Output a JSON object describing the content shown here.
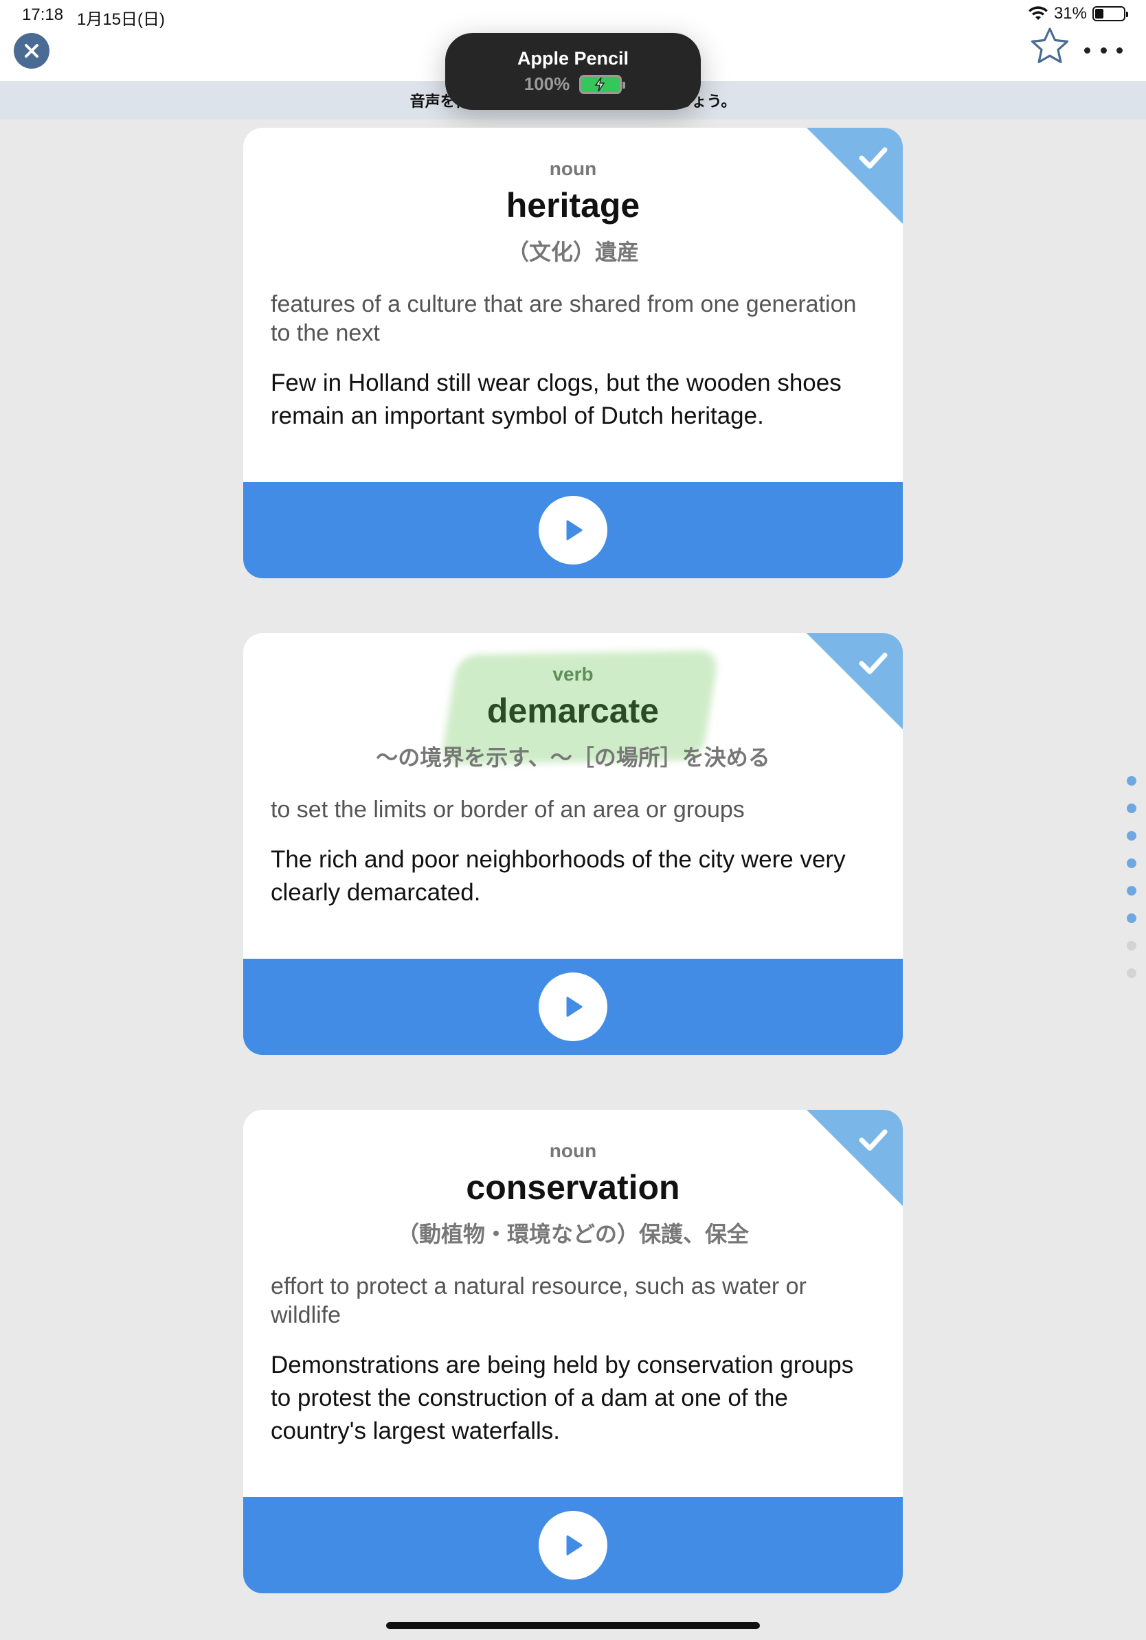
{
  "status_bar": {
    "time": "17:18",
    "date": "1月15日(日)",
    "battery": "31%"
  },
  "instruction": {
    "text_left": "音声を再",
    "text_right": "しょう。"
  },
  "pencil_hud": {
    "title": "Apple Pencil",
    "percent": "100%"
  },
  "cards": [
    {
      "pos": "noun",
      "word": "heritage",
      "jp": "（文化）遺産",
      "definition": "features of a culture that are shared from one generation to the next",
      "example": "Few in Holland still wear clogs, but the wooden shoes remain an important symbol of Dutch heritage.",
      "checked": true
    },
    {
      "pos": "verb",
      "word": "demarcate",
      "jp": "〜の境界を示す、〜［の場所］を決める",
      "definition": "to set the limits or border of an area or groups",
      "example": "The rich and poor neighborhoods of the city were very clearly demarcated.",
      "checked": true,
      "highlighted": true
    },
    {
      "pos": "noun",
      "word": "conservation",
      "jp": "（動植物・環境などの）保護、保全",
      "definition": "effort to protect a natural resource, such as water or wildlife",
      "example": "Demonstrations are being held by conservation groups to protest the construction of a dam at one of the country's largest waterfalls.",
      "checked": true
    }
  ],
  "page_indicator": {
    "total": 8,
    "filled": 6
  },
  "colors": {
    "accent": "#428ce6",
    "check_corner": "#7ab7e8",
    "close_button": "#4a6b93",
    "highlight": "#80ce6e"
  }
}
